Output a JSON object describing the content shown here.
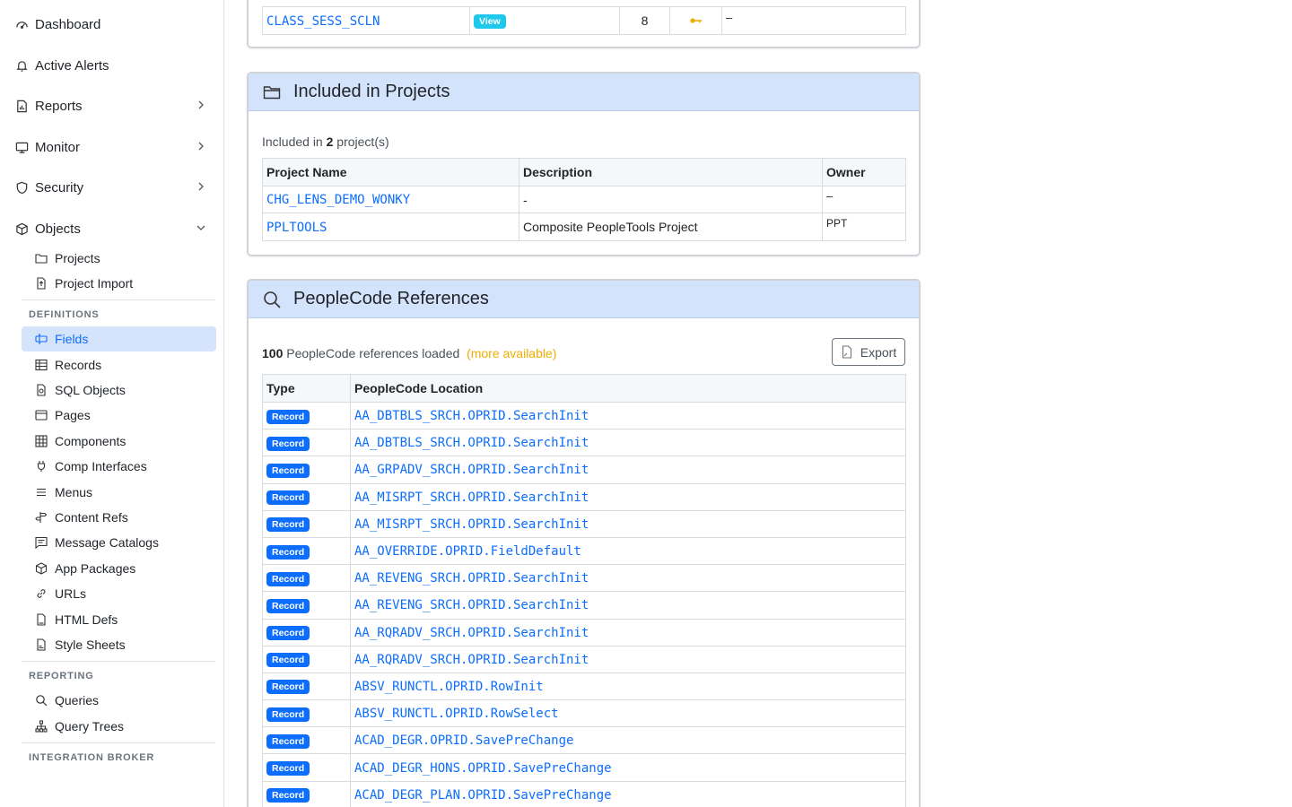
{
  "sidebar": {
    "top_items": [
      {
        "label": "Dashboard",
        "icon": "dashboard-icon"
      },
      {
        "label": "Active Alerts",
        "icon": "bell-icon"
      },
      {
        "label": "Reports",
        "icon": "report-icon"
      },
      {
        "label": "Monitor",
        "icon": "monitor-icon"
      },
      {
        "label": "Security",
        "icon": "shield-icon"
      },
      {
        "label": "Objects",
        "icon": "box-icon"
      }
    ],
    "objects_items": [
      {
        "label": "Projects",
        "icon": "folder-icon"
      },
      {
        "label": "Project Import",
        "icon": "file-import-icon"
      }
    ],
    "definitions_heading": "DEFINITIONS",
    "definitions_items": [
      {
        "label": "Fields",
        "icon": "field-icon"
      },
      {
        "label": "Records",
        "icon": "table-icon"
      },
      {
        "label": "SQL Objects",
        "icon": "sql-file-icon"
      },
      {
        "label": "Pages",
        "icon": "window-icon"
      },
      {
        "label": "Components",
        "icon": "grid-icon"
      },
      {
        "label": "Comp Interfaces",
        "icon": "plug-icon"
      },
      {
        "label": "Menus",
        "icon": "list-icon"
      },
      {
        "label": "Content Refs",
        "icon": "signpost-icon"
      },
      {
        "label": "Message Catalogs",
        "icon": "message-icon"
      },
      {
        "label": "App Packages",
        "icon": "package-icon"
      },
      {
        "label": "URLs",
        "icon": "link-icon"
      },
      {
        "label": "HTML Defs",
        "icon": "html-file-icon"
      },
      {
        "label": "Style Sheets",
        "icon": "css-file-icon"
      }
    ],
    "reporting_heading": "REPORTING",
    "reporting_items": [
      {
        "label": "Queries",
        "icon": "search-icon"
      },
      {
        "label": "Query Trees",
        "icon": "tree-icon"
      }
    ],
    "integration_heading": "INTEGRATION BROKER"
  },
  "top_table_row": {
    "name": "CLASS_SESS_SCLN",
    "badge": "View",
    "count": "8",
    "key_icon": "key-icon",
    "dash": "–"
  },
  "projects_card": {
    "title": "Included in Projects",
    "summary_prefix": "Included in ",
    "summary_count": "2",
    "summary_suffix": " project(s)",
    "headers": [
      "Project Name",
      "Description",
      "Owner"
    ],
    "rows": [
      {
        "name": "CHG_LENS_DEMO_WONKY",
        "description": "-",
        "owner": "–"
      },
      {
        "name": "PPLTOOLS",
        "description": "Composite PeopleTools Project",
        "owner": "PPT"
      }
    ]
  },
  "peoplecode_card": {
    "title": "PeopleCode References",
    "count": "100",
    "loaded_text": " PeopleCode references loaded",
    "more_text": "(more available)",
    "export_label": "Export",
    "headers": [
      "Type",
      "PeopleCode Location"
    ],
    "rows": [
      {
        "type": "Record",
        "location": "AA_DBTBLS_SRCH.OPRID.SearchInit"
      },
      {
        "type": "Record",
        "location": "AA_DBTBLS_SRCH.OPRID.SearchInit"
      },
      {
        "type": "Record",
        "location": "AA_GRPADV_SRCH.OPRID.SearchInit"
      },
      {
        "type": "Record",
        "location": "AA_MISRPT_SRCH.OPRID.SearchInit"
      },
      {
        "type": "Record",
        "location": "AA_MISRPT_SRCH.OPRID.SearchInit"
      },
      {
        "type": "Record",
        "location": "AA_OVERRIDE.OPRID.FieldDefault"
      },
      {
        "type": "Record",
        "location": "AA_REVENG_SRCH.OPRID.SearchInit"
      },
      {
        "type": "Record",
        "location": "AA_REVENG_SRCH.OPRID.SearchInit"
      },
      {
        "type": "Record",
        "location": "AA_RQRADV_SRCH.OPRID.SearchInit"
      },
      {
        "type": "Record",
        "location": "AA_RQRADV_SRCH.OPRID.SearchInit"
      },
      {
        "type": "Record",
        "location": "ABSV_RUNCTL.OPRID.RowInit"
      },
      {
        "type": "Record",
        "location": "ABSV_RUNCTL.OPRID.RowSelect"
      },
      {
        "type": "Record",
        "location": "ACAD_DEGR.OPRID.SavePreChange"
      },
      {
        "type": "Record",
        "location": "ACAD_DEGR_HONS.OPRID.SavePreChange"
      },
      {
        "type": "Record",
        "location": "ACAD_DEGR_PLAN.OPRID.SavePreChange"
      }
    ]
  },
  "colors": {
    "accent": "#0d6efd",
    "header_bg": "#d3e3fc",
    "active_bg": "#d6e4fb",
    "more_text": "#f0ad00",
    "view_badge": "#1ec8ea"
  }
}
